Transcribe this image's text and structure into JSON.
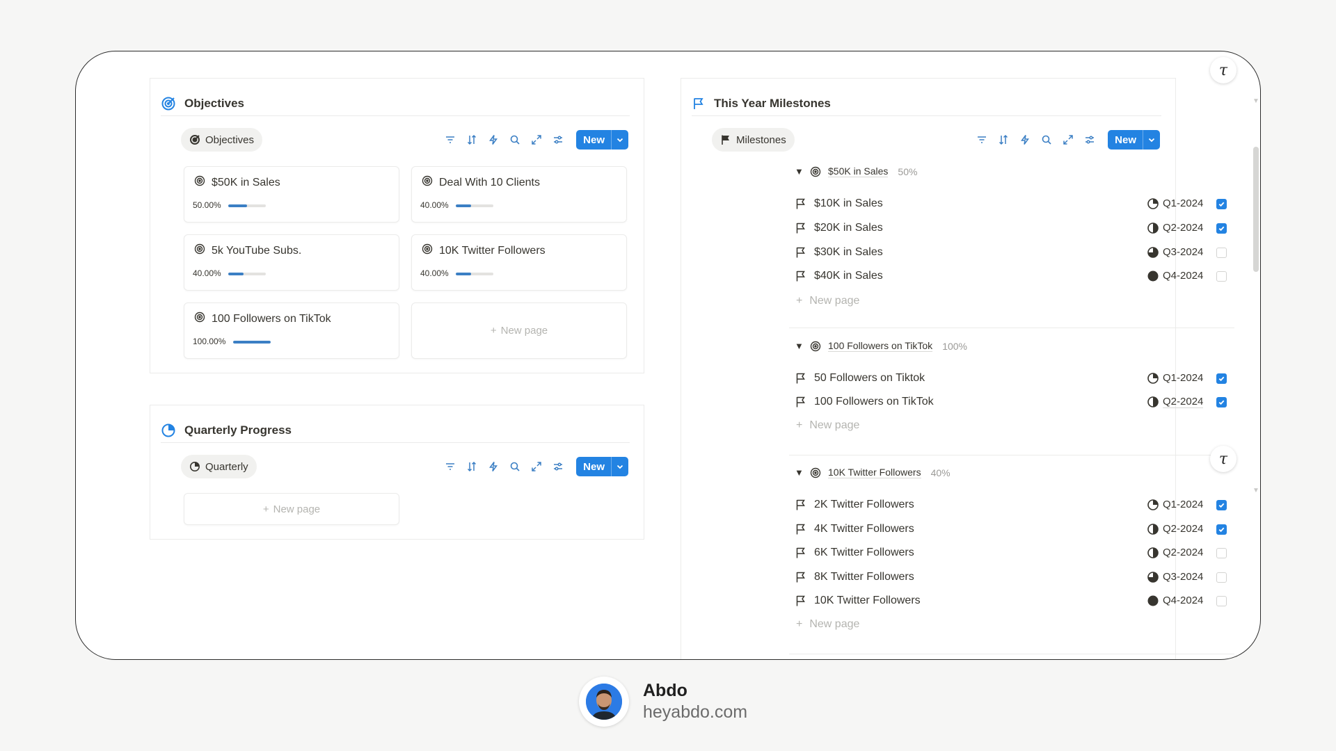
{
  "objectives": {
    "title": "Objectives",
    "view_tab": "Objectives",
    "new_label": "New",
    "cards": [
      {
        "title": "$50K in Sales",
        "pct_text": "50.00%",
        "progress": 0.5
      },
      {
        "title": "Deal With 10 Clients",
        "pct_text": "40.00%",
        "progress": 0.4
      },
      {
        "title": "5k YouTube Subs.",
        "pct_text": "40.00%",
        "progress": 0.4
      },
      {
        "title": "10K Twitter Followers",
        "pct_text": "40.00%",
        "progress": 0.4
      },
      {
        "title": "100 Followers on TikTok",
        "pct_text": "100.00%",
        "progress": 1.0
      }
    ],
    "new_page": "New page"
  },
  "quarterly": {
    "title": "Quarterly Progress",
    "view_tab": "Quarterly",
    "new_label": "New",
    "new_page": "New page"
  },
  "milestones": {
    "title": "This Year Milestones",
    "view_tab": "Milestones",
    "new_label": "New",
    "new_page": "New page",
    "groups": [
      {
        "name": "$50K in Sales",
        "pct": "50%",
        "rows": [
          {
            "name": "$10K in Sales",
            "quarter": "Q1-2024",
            "done": true
          },
          {
            "name": "$20K in Sales",
            "quarter": "Q2-2024",
            "done": true
          },
          {
            "name": "$30K in Sales",
            "quarter": "Q3-2024",
            "done": false
          },
          {
            "name": "$40K in Sales",
            "quarter": "Q4-2024",
            "done": false
          }
        ]
      },
      {
        "name": "100 Followers on TikTok",
        "pct": "100%",
        "rows": [
          {
            "name": "50 Followers on Tiktok",
            "quarter": "Q1-2024",
            "done": true
          },
          {
            "name": "100 Followers on TikTok",
            "quarter": "Q2-2024",
            "done": true
          }
        ]
      },
      {
        "name": "10K Twitter Followers",
        "pct": "40%",
        "rows": [
          {
            "name": "2K Twitter Followers",
            "quarter": "Q1-2024",
            "done": true
          },
          {
            "name": "4K Twitter Followers",
            "quarter": "Q2-2024",
            "done": true
          },
          {
            "name": "6K Twitter Followers",
            "quarter": "Q2-2024",
            "done": false
          },
          {
            "name": "8K Twitter Followers",
            "quarter": "Q3-2024",
            "done": false
          },
          {
            "name": "10K Twitter Followers",
            "quarter": "Q4-2024",
            "done": false
          }
        ]
      }
    ]
  },
  "footer": {
    "name": "Abdo",
    "site": "heyabdo.com"
  },
  "colors": {
    "accent": "#2383e2",
    "progress": "#3b7fc4"
  }
}
